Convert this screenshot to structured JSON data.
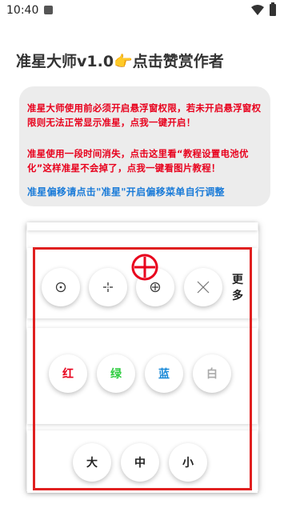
{
  "status": {
    "time": "10:40"
  },
  "header": {
    "title": "准星大师v1.0👉点击赞赏作者"
  },
  "notice": {
    "line1": "准星大师使用前必须开启悬浮窗权限，若未开启悬浮窗权限则无法正常显示准星，点我一键开启！",
    "line2": "准星使用一段时间消失，点击这里看“教程设置电池优化”这样准星不会掉了，点我一键看图片教程！",
    "line3": "准星偏移请点击\"准星\"开启偏移菜单自行调整"
  },
  "styles": {
    "more_label": "更多"
  },
  "colors": {
    "label": "红",
    "label_green": "绿",
    "label_blue": "蓝",
    "label_white": "白",
    "red": "#e8001c",
    "green": "#2ecc40",
    "blue": "#1a8ad8",
    "white": "#aaaaaa"
  },
  "sizes": {
    "large": "大",
    "medium": "中",
    "small": "小"
  },
  "icons": [
    "circle-dot-icon",
    "crosshair-plus-icon",
    "circle-plus-icon",
    "x-icon",
    "red-crosshair-icon"
  ]
}
